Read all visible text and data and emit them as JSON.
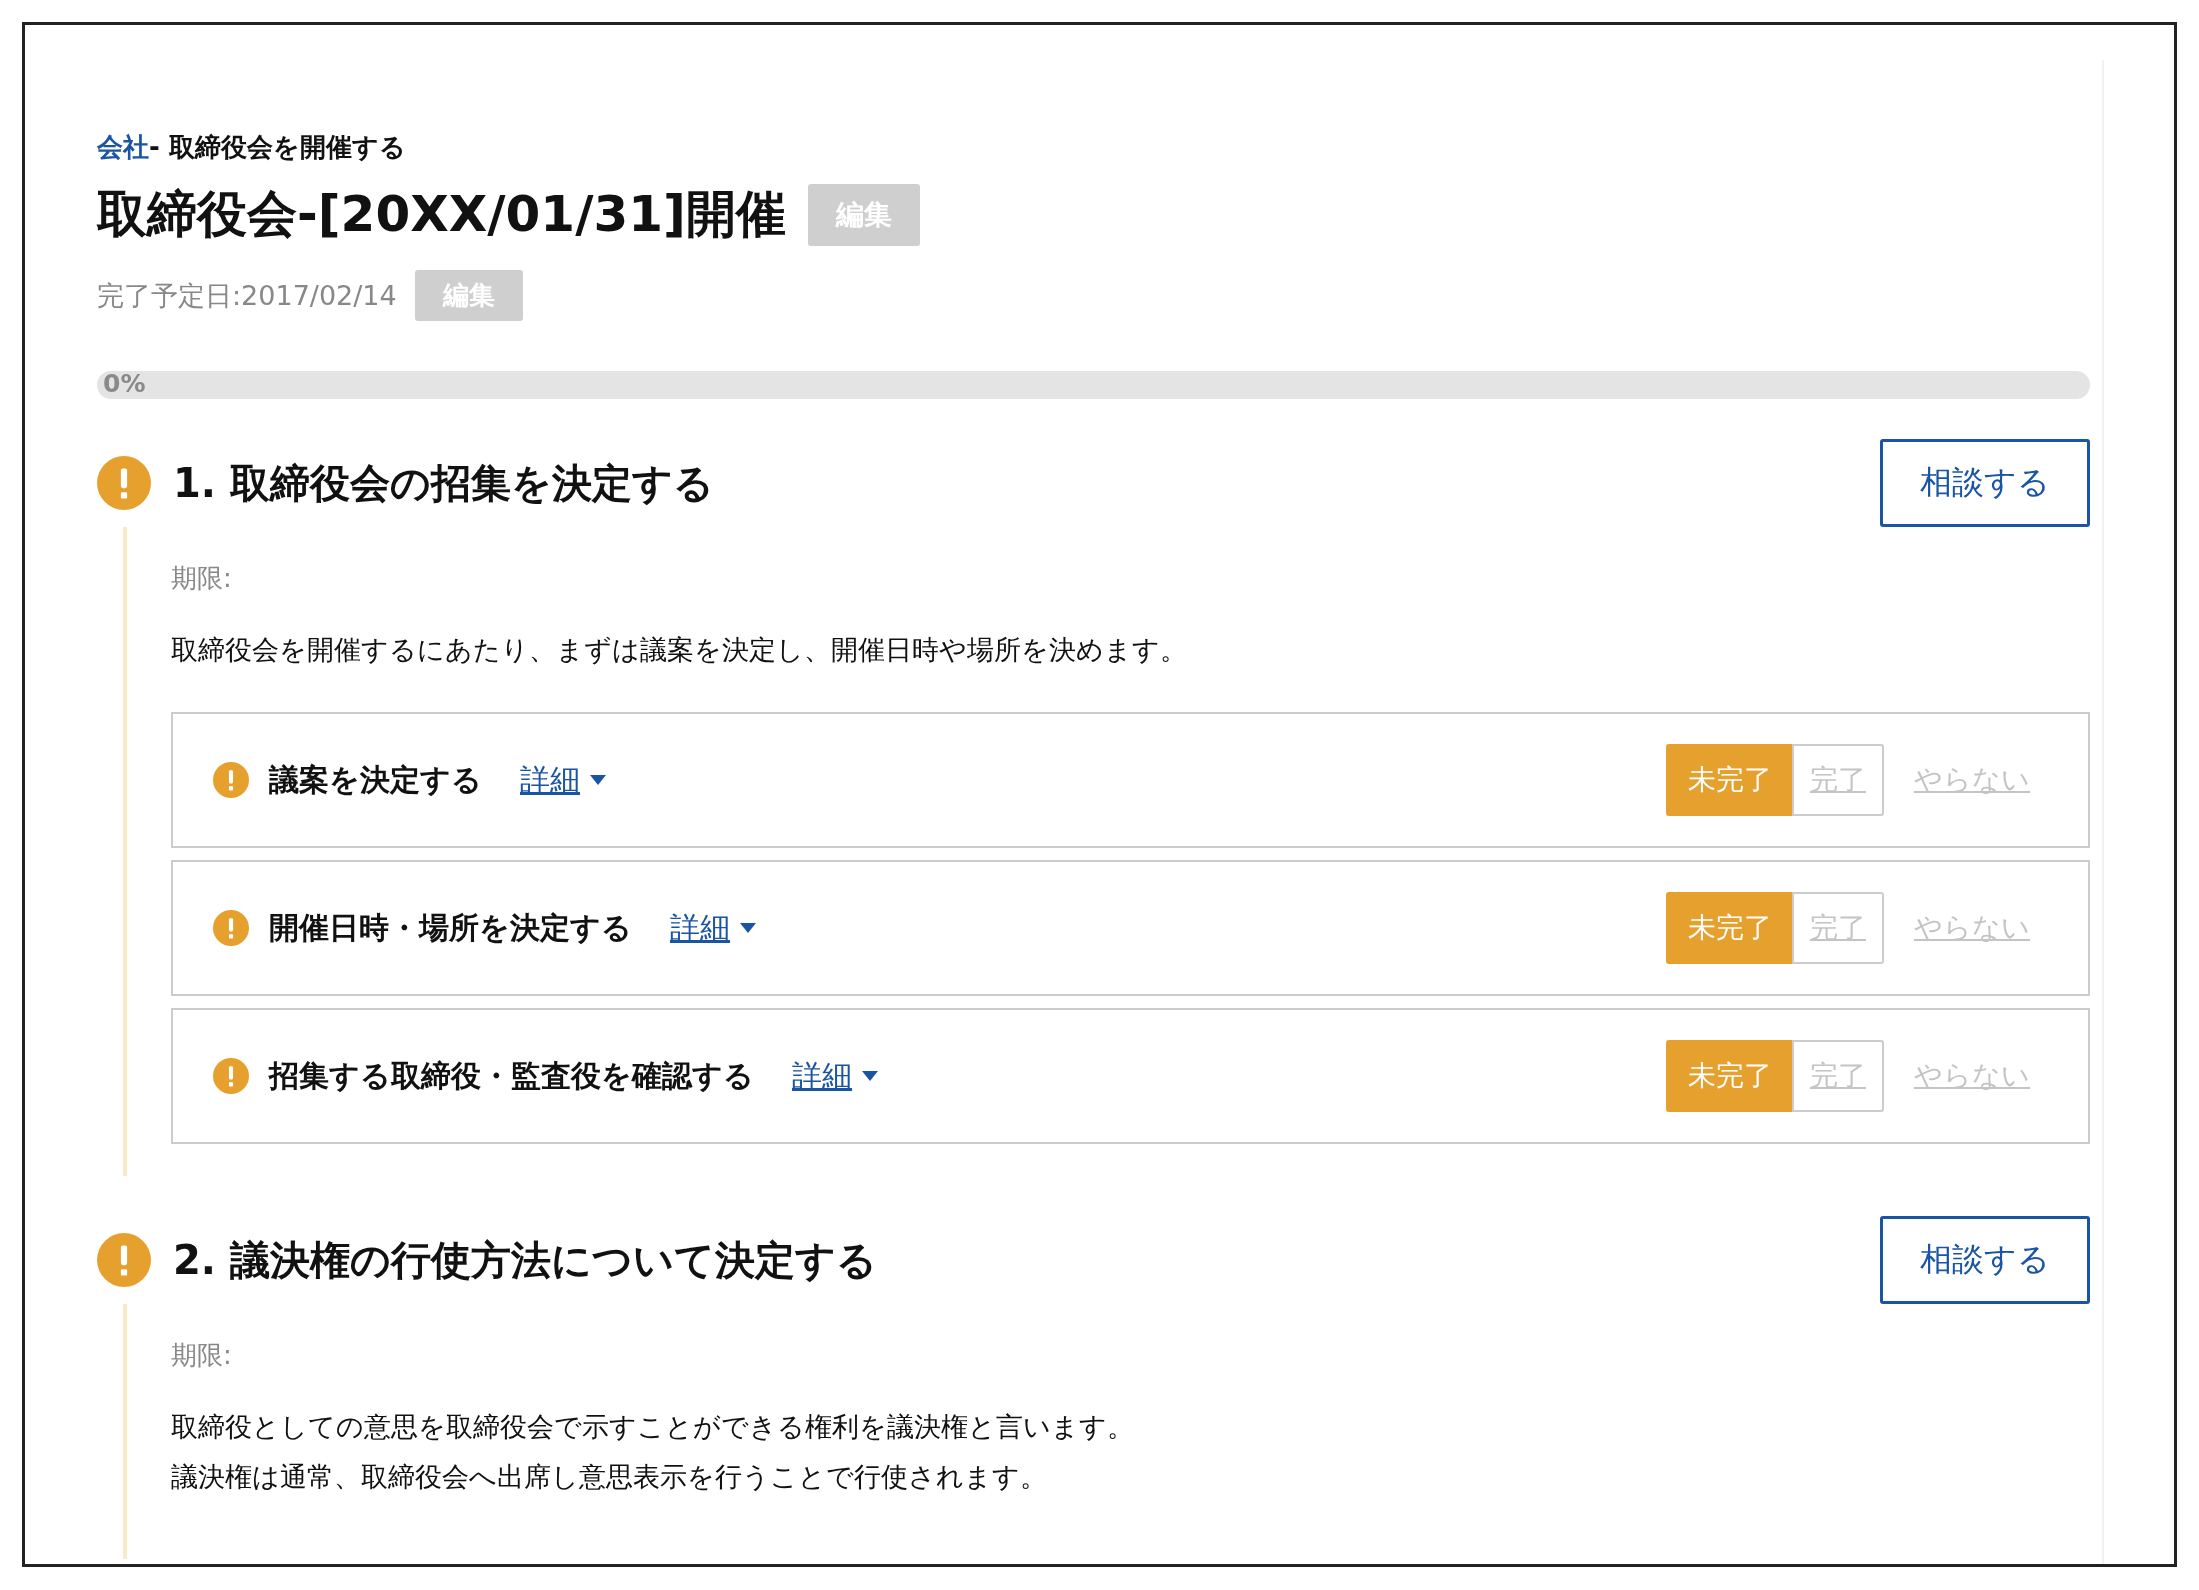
{
  "breadcrumb": {
    "link": "会社",
    "rest": "- 取締役会を開催する"
  },
  "title": "取締役会-[20XX/01/31]開催",
  "title_edit_button": "編集",
  "due_date": "完了予定日:2017/02/14",
  "due_edit_button": "編集",
  "progress": {
    "level": 0,
    "reading": "0%"
  },
  "sections": [
    {
      "heading": "1. 取締役会の招集を決定する",
      "consult_button": "相談する",
      "deadline_label": "期限:",
      "description": [
        "取締役会を開催するにあたり、まずは議案を決定し、開催日時や場所を決めます。"
      ],
      "tasks": [
        {
          "title": "議案を決定する",
          "detail_link": "詳細",
          "options": [
            {
              "label": "未完了",
              "kind": "segment",
              "selected": true
            },
            {
              "label": "完了",
              "kind": "segment",
              "selected": false
            },
            {
              "label": "やらない",
              "kind": "link",
              "selected": false
            }
          ]
        },
        {
          "title": "開催日時・場所を決定する",
          "detail_link": "詳細",
          "options": [
            {
              "label": "未完了",
              "kind": "segment",
              "selected": true
            },
            {
              "label": "完了",
              "kind": "segment",
              "selected": false
            },
            {
              "label": "やらない",
              "kind": "link",
              "selected": false
            }
          ]
        },
        {
          "title": "招集する取締役・監査役を確認する",
          "detail_link": "詳細",
          "options": [
            {
              "label": "未完了",
              "kind": "segment",
              "selected": true
            },
            {
              "label": "完了",
              "kind": "segment",
              "selected": false
            },
            {
              "label": "やらない",
              "kind": "link",
              "selected": false
            }
          ]
        }
      ]
    },
    {
      "heading": "2. 議決権の行使方法について決定する",
      "consult_button": "相談する",
      "deadline_label": "期限:",
      "description": [
        "取締役としての意思を取締役会で示すことができる権利を議決権と言います。",
        "議決権は通常、取締役会へ出席し意思表示を行うことで行使されます。"
      ]
    }
  ]
}
